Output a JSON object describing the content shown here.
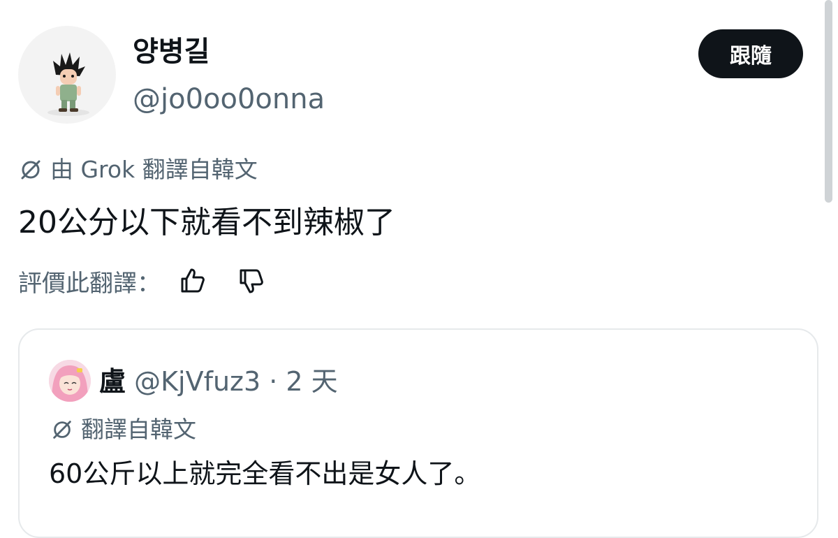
{
  "author": {
    "display_name": "양병길",
    "handle": "@jo0oo0onna",
    "follow_label": "跟隨"
  },
  "translation_notice": {
    "text": "由 Grok 翻譯自韓文",
    "icon": "translate-slash-icon"
  },
  "tweet": {
    "text": "20公分以下就看不到辣椒了"
  },
  "rating": {
    "label": "評價此翻譯：",
    "thumbs_up_icon": "thumbs-up-icon",
    "thumbs_down_icon": "thumbs-down-icon"
  },
  "quoted_tweet": {
    "display_name": "盧",
    "handle": "@KjVfuz3",
    "separator": " · ",
    "time": "2 天",
    "translation_notice": "翻譯自韓文",
    "text": "60公斤以上就完全看不出是女人了。"
  },
  "colors": {
    "text_primary": "#0f1419",
    "text_secondary": "#536471",
    "button_bg": "#0f1419",
    "border": "#e6e9eb"
  }
}
